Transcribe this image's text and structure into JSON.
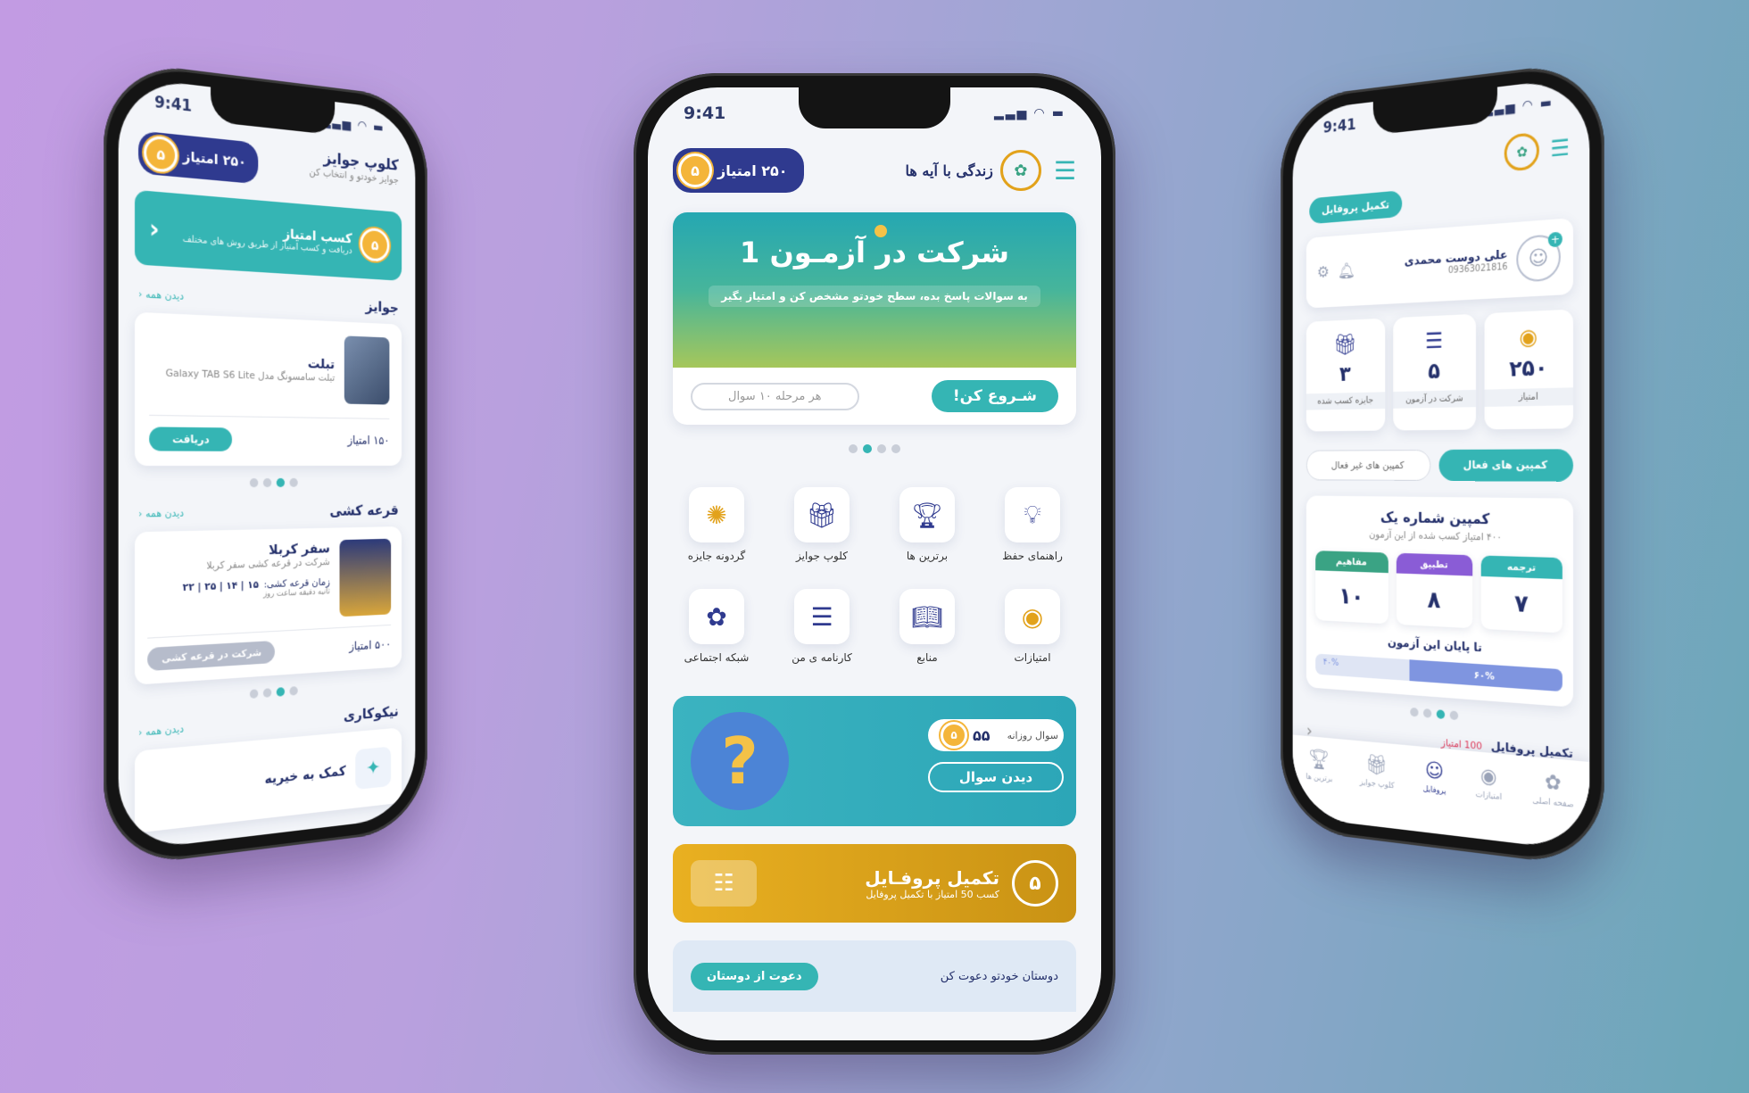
{
  "colors": {
    "teal": "#35b5b4",
    "navy": "#2f3a8f",
    "gold": "#e2a21b",
    "green": "#3aa384",
    "purple": "#8a5cd6"
  },
  "status_time": "9:41",
  "left": {
    "score": "۲۵۰ امتیاز",
    "header_title": "کلوپ جوایز",
    "header_sub": "جوایز خودتو و انتخاب کن",
    "earn_title": "کسب امتیاز",
    "earn_sub": "دریافت و کسب امتیاز از طریق روش های مختلف",
    "prizes_title": "جوایز",
    "see_all": "دیدن همه",
    "prize_name": "تبلت",
    "prize_desc": "تبلت سامسونگ مدل Galaxy TAB S6 Lite",
    "prize_points": "۱۵۰ امتیاز",
    "prize_btn": "دریافت",
    "lottery_title": "قرعه کشی",
    "lottery_name": "سفر کربلا",
    "lottery_desc": "شرکت در قرعه کشی سفر کربلا",
    "lottery_time_label": "زمان قرعه کشی:",
    "lottery_time": "۱۵ | ۱۴ | ۲۵ | ۲۲",
    "lottery_units": "ثانیه دقیقه ساعت روز",
    "lottery_points": "۵۰۰ امتیاز",
    "lottery_btn": "شرکت در قرعه کشی",
    "charity_title": "نیکوکاری",
    "charity_name": "کمک به خیریه"
  },
  "center": {
    "logo_text": "زندگی با آیه ها",
    "score": "۲۵۰ امتیاز",
    "banner_title": "شرکت در آزمـون 1",
    "banner_sub": "به سوالات پاسخ بده، سطح خودتو مشخص کن و امتیاز بگیر",
    "banner_start": "شـروع کن!",
    "banner_info": "هر مرحله ۱۰ سوال",
    "menu": [
      {
        "label": "راهنمای حفظ",
        "icon": "book-idea-icon"
      },
      {
        "label": "برترین ها",
        "icon": "trophy-icon"
      },
      {
        "label": "کلوپ جوایز",
        "icon": "gift-icon"
      },
      {
        "label": "گردونه جایزه",
        "icon": "wheel-icon"
      },
      {
        "label": "امتیازات",
        "icon": "coin-icon"
      },
      {
        "label": "منابع",
        "icon": "open-book-icon"
      },
      {
        "label": "کارنامه ی من",
        "icon": "report-icon"
      },
      {
        "label": "شبکه اجتماعی",
        "icon": "social-icon"
      }
    ],
    "daily_label": "سوال روزانه",
    "daily_points": "۵۵",
    "daily_btn": "دیدن سوال",
    "profile_title": "تکمیل پروفـایل",
    "profile_sub": "کسب 50 امتیاز با تکمیل پروفایل",
    "invite_text": "دوستان خودتو دعوت کن",
    "invite_btn": "دعوت از دوستان"
  },
  "right": {
    "complete_btn": "تکمیل پروفایل",
    "user_name": "علی دوست محمدی",
    "user_phone": "09363021816",
    "stats": [
      {
        "value": "۲۵۰",
        "label": "امتیاز"
      },
      {
        "value": "۵",
        "label": "شرکت در آزمون"
      },
      {
        "value": "۳",
        "label": "جایزه کسب شده"
      }
    ],
    "tab_active": "کمپین های فعال",
    "tab_inactive": "کمپین های غیر فعال",
    "campaign_title": "کمپین شماره یک",
    "campaign_sub": "۴۰۰ امتیاز کسب شده از این آزمون",
    "scores": [
      {
        "label": "ترجمه",
        "value": "۷"
      },
      {
        "label": "تطبیق",
        "value": "۸"
      },
      {
        "label": "مفاهیم",
        "value": "۱۰"
      }
    ],
    "remaining_label": "تا پایان این آزمون",
    "progress_value": "۶۰%",
    "progress_rest": "۴۰%",
    "progress_fraction": 0.6,
    "footer_text": "تکمیل پروفایل",
    "footer_points": "100 امتیاز",
    "nav": [
      {
        "label": "صفحه اصلی",
        "icon": "home-logo-icon"
      },
      {
        "label": "امتیازات",
        "icon": "coin-icon"
      },
      {
        "label": "پروفایل",
        "icon": "profile-icon"
      },
      {
        "label": "کلوپ جوایز",
        "icon": "gift-icon"
      },
      {
        "label": "برترین ها",
        "icon": "trophy-icon"
      }
    ]
  }
}
